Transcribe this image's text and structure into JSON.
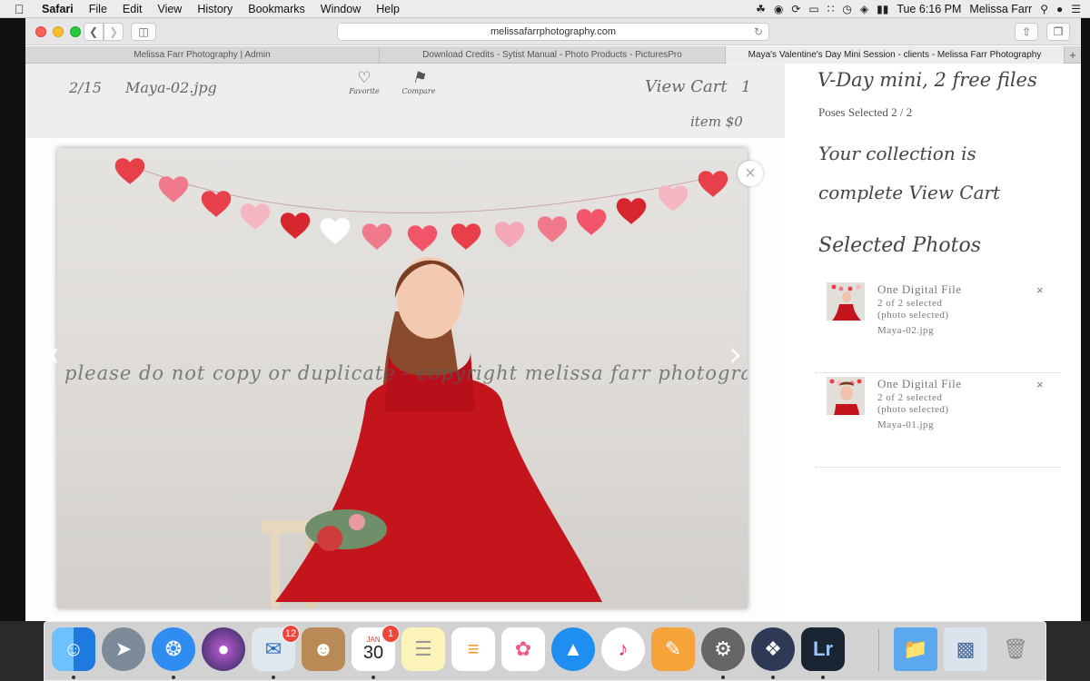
{
  "menubar": {
    "apple_icon": "apple-logo",
    "items": [
      "Safari",
      "File",
      "Edit",
      "View",
      "History",
      "Bookmarks",
      "Window",
      "Help"
    ],
    "clock": "Tue 6:16 PM",
    "user": "Melissa Farr"
  },
  "browser": {
    "url": "melissafarrphotography.com",
    "tabs": [
      "Melissa Farr Photography | Admin",
      "Download Credits - Sytist Manual - Photo Products - PicturesPro",
      "Maya's Valentine's Day Mini Session - clients - Melissa Farr Photography"
    ],
    "new_tab": "+"
  },
  "gallery": {
    "counter": "2/15",
    "filename": "Maya-02.jpg",
    "favorite_label": "Favorite",
    "compare_label": "Compare",
    "view_cart": "View Cart",
    "cart_count": "1",
    "cart_item": "item $0",
    "watermark": "please do not copy or duplicate - copyright melissa farr photography",
    "close": "×",
    "prev": "‹",
    "next": "›"
  },
  "sidebar": {
    "session_title": "V-Day mini, 2 free files",
    "poses_selected": "Poses Selected 2 / 2",
    "collection_line1": "Your collection is",
    "collection_line2": "complete View Cart",
    "selected_heading": "Selected Photos",
    "selected": [
      {
        "name": "One Digital File",
        "count": "2 of 2 selected",
        "status": "(photo selected)",
        "file": "Maya-02.jpg",
        "remove": "×"
      },
      {
        "name": "One Digital File",
        "count": "2 of 2 selected",
        "status": "(photo selected)",
        "file": "Maya-01.jpg",
        "remove": "×"
      }
    ]
  },
  "dock": {
    "items": [
      "Finder",
      "Launchpad",
      "Safari",
      "Siri",
      "Mail",
      "Contacts",
      "Calendar",
      "Notes",
      "Reminders",
      "Photos",
      "App Store",
      "iTunes",
      "Pages",
      "System Preferences",
      "Aperture",
      "Lightroom"
    ],
    "mail_badge": "12",
    "calendar_badge": "1",
    "calendar_month": "JAN",
    "calendar_day": "30",
    "lightroom_label": "Lr"
  },
  "colors": {
    "heart_red": "#e8404a",
    "heart_pink": "#f2a7b4",
    "dress_red": "#c4141c"
  }
}
